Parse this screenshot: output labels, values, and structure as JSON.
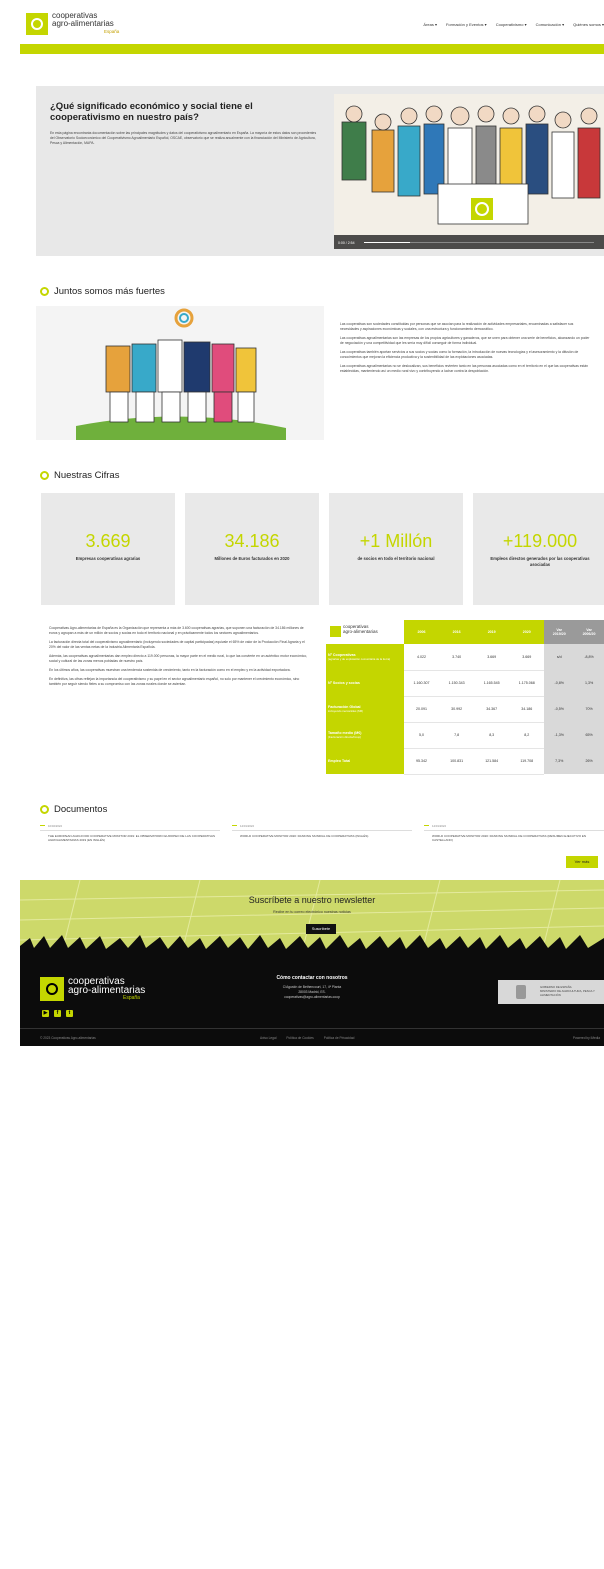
{
  "header": {
    "logo_line1": "cooperativas",
    "logo_line2": "agro-alimentarias",
    "logo_sub": "España",
    "nav": [
      "Áreas ▾",
      "Formación y Eventos ▾",
      "Cooperativismo ▾",
      "Comunicación ▾",
      "Quiénes somos ▾"
    ]
  },
  "hero": {
    "title": "¿Qué significado económico y social tiene el cooperativismo en nuestro país?",
    "body": "En esta página encontrarás documentación sobre las principales magnitudes y datos del cooperativismo agroalimentario en España. La mayoría de estos datos son procedentes del Observatorio Socioeconómico del Cooperativismo Agroalimentario Español, OSCAE, observatorio que se realiza anualmente con la financiación del Ministerio de Agricultura, Pesca y Alimentación, MAPA.",
    "video_time": "0:00 / 2:54",
    "video_progress": 0.2
  },
  "juntos": {
    "heading": "Juntos somos más fuertes",
    "paragraphs": [
      "Las cooperativas son sociedades constituidas por personas que se asocian para la realización de actividades empresariales, encaminadas a satisfacer sus necesidades y aspiraciones económicas y sociales, con una estructura y funcionamiento democrático.",
      "Las cooperativas agroalimentarias son las empresas de los propios agricultores y ganaderos, que se unen para obtener una serie de beneficios, alcanzando un poder de negociación y una competitividad que les sería muy difícil conseguir de forma individual.",
      "Las cooperativas también aportan servicios a sus socios y socias como la formación, la introducción de nuevas tecnologías y el asesoramiento y la difusión de conocimientos que mejoran la eficiencia productiva y la sostenibilidad de las explotaciones asociadas.",
      "Las cooperativas agroalimentarias no se deslocalizan, sus beneficios revierten tanto en las personas asociadas como en el territorio en el que las cooperativas están establecidas, manteniendo así un medio rural vivo y contribuyendo a luchar contra la despoblación."
    ]
  },
  "cifras": {
    "heading": "Nuestras Cifras",
    "stats": [
      {
        "value": "3.669",
        "label": "Empresas cooperativas agrarias"
      },
      {
        "value": "34.186",
        "label": "Millones de Euros facturados en 2020"
      },
      {
        "value": "+1 Millón",
        "label": "de socios en todo el territorio nacional"
      },
      {
        "value": "+119.000",
        "label": "Empleos directos generados por las cooperativas asociadas"
      }
    ]
  },
  "summary": {
    "paragraphs": [
      "Cooperativas Agro-alimentarias de España es la Organización que representa a más de 3.600 cooperativas agrarias, que suponen una facturación de 34.186 millones de euros y agrupan a más de un millón de socios y socias en todo el territorio nacional y en prácticamente todos los sectores agroalimentarios.",
      "La facturación directa total del cooperativismo agroalimentario (incluyendo sociedades de capital participadas) equivale el 65% de valor de la Producción Final Agraria y el 20% del valor de las ventas netas de la industria Alimentaria Española.",
      "Además, las cooperativas agroalimentarias dan empleo directo a 119.000 personas, la mayor parte en el medio rural, lo que las convierte en un auténtico motor económico, social y cultural de las zonas menos pobladas de nuestro país.",
      "En los últimos años, las cooperativas muestran una tendencia sostenida de crecimiento, tanto en la facturación como en el empleo y en la actividad exportadora.",
      "En definitiva, las cifras reflejan la importancia del cooperativismo y su papel en el sector agroalimentario español, no solo por mantener el crecimiento económico, sino también por seguir siendo fieles a su compromiso con las zonas rurales donde se asientan."
    ]
  },
  "table": {
    "years": [
      "2006",
      "2016",
      "2019",
      "2020"
    ],
    "var_headers": [
      [
        "Var",
        "2019/20"
      ],
      [
        "Var",
        "2006/20"
      ]
    ],
    "rows": [
      {
        "label": "Nº Cooperativas",
        "sub": "(agrarias y de explotación comunitaria de la tierra)",
        "values": [
          "4.022",
          "3.740",
          "3.669",
          "3.669"
        ],
        "vars": [
          "s/d",
          "-8,8%"
        ]
      },
      {
        "label": "Nº Socios y socias",
        "sub": "",
        "values": [
          "1.160.307",
          "1.150.343",
          "1.165.545",
          "1.175.068"
        ],
        "vars": [
          "-0,8%",
          "1,3%"
        ]
      },
      {
        "label": "Facturación Global",
        "sub": "incluyendo mercantiles (M€)",
        "values": [
          "20.091",
          "30.992",
          "34.367",
          "34.186"
        ],
        "vars": [
          "-0,5%",
          "70%"
        ]
      },
      {
        "label": "Tamaño medio (M€)",
        "sub": "(Facturación directa/Coop)",
        "values": [
          "5,0",
          "7,8",
          "8,3",
          "8,2"
        ],
        "vars": [
          "-1,3%",
          "65%"
        ]
      },
      {
        "label": "Empleo Total",
        "sub": "",
        "values": [
          "95.342",
          "100.831",
          "121.584",
          "119.708"
        ],
        "vars": [
          "7,3%",
          "26%"
        ]
      }
    ]
  },
  "documentos": {
    "heading": "Documentos",
    "items": [
      {
        "date": "10/02/2022",
        "title": "THE EUROPEAN AGRI-FOOD COOPERATIVE MONITOR 2019: EL OBSERVATORIO EUROPEO DE LAS COOPERATIVAS AGROALIMENTARIAS 2019 (EN INGLÉS)"
      },
      {
        "date": "14/01/2022",
        "title": "WORLD COOPERATIVE MONITOR 2020: RANKING MUNDIAL DE COOPERATIVAS (INGLÉS)"
      },
      {
        "date": "14/01/2022",
        "title": "WORLD COOPERATIVE MONITOR 2020: RANKING MUNDIAL DE COOPERATIVAS (RESUMEN EJECUTIVO EN CASTELLANO)"
      }
    ],
    "more": "Ver más"
  },
  "newsletter": {
    "title": "Suscríbete a nuestro newsletter",
    "subtitle": "Recibe en tu correo electrónico nuestras noticias",
    "button": "Suscríbete"
  },
  "footer": {
    "logo_line1": "cooperativas",
    "logo_line2": "agro-alimentarias",
    "logo_sub": "España",
    "contact_title": "Cómo contactar con nosotros",
    "contact_lines": [
      "C/Agustín de Bethencourt, 17, 4ª Planta",
      "28003 Madrid, ES.",
      "cooperativas@agro-alimentarias.coop"
    ],
    "gov_lines": [
      "GOBIERNO DE ESPAÑA",
      "MINISTERIO DE AGRICULTURA, PESCA Y ALIMENTACIÓN"
    ],
    "copyright": "© 2023 Cooperativas Agro-alimentarias",
    "legal": [
      "Aviso Legal",
      "Política de Cookies",
      "Política de Privacidad"
    ],
    "powered": "Powered by iMedia"
  },
  "colors": {
    "accent": "#c4d600",
    "footer_bg": "#0c0c0c",
    "card_bg": "#e9e9e9"
  }
}
